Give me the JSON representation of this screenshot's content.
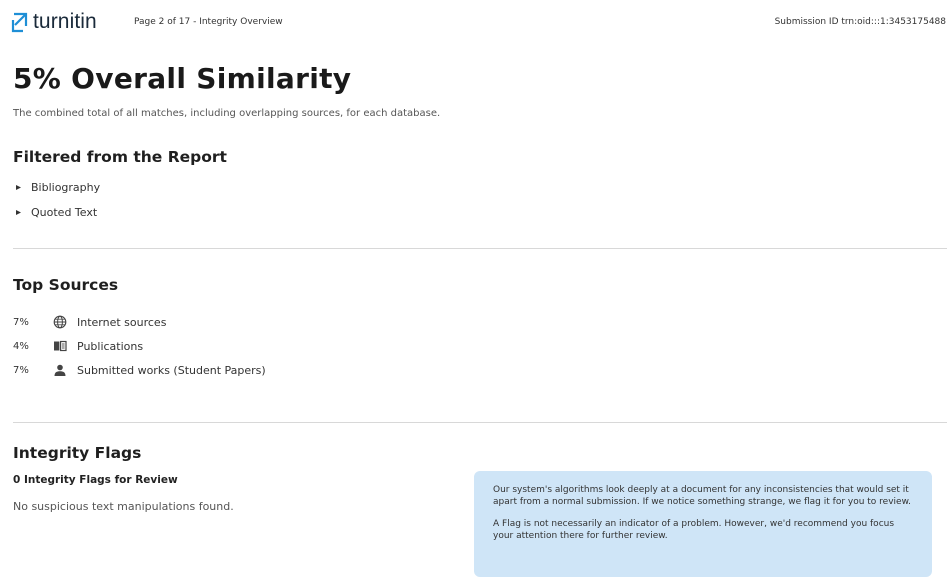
{
  "header": {
    "logo_text": "turnitin",
    "page_info": "Page 2 of 17 - Integrity Overview",
    "submission_id": "Submission ID  trn:oid:::1:3453175488"
  },
  "overview": {
    "title": "5%  Overall Similarity",
    "subtitle": "The combined total of all matches, including overlapping sources, for each database."
  },
  "filtered": {
    "heading": "Filtered from the Report",
    "items": [
      "Bibliography",
      "Quoted Text"
    ]
  },
  "top_sources": {
    "heading": "Top Sources",
    "items": [
      {
        "pct": "7%",
        "label": "Internet sources",
        "icon": "globe-icon"
      },
      {
        "pct": "4%",
        "label": "Publications",
        "icon": "book-icon"
      },
      {
        "pct": "7%",
        "label": "Submitted works (Student Papers)",
        "icon": "person-icon"
      }
    ]
  },
  "integrity_flags": {
    "heading": "Integrity Flags",
    "count_label": "0 Integrity Flags for Review",
    "status": "No suspicious text manipulations found.",
    "info_p1": "Our system's algorithms look deeply at a document for any inconsistencies that would set it apart from a normal submission. If we notice something strange, we flag it for you to review.",
    "info_p2": "A Flag is not necessarily an indicator of a problem. However, we'd recommend you focus your attention there for further review."
  },
  "colors": {
    "logo_accent": "#1f8fd6",
    "info_box_bg": "#cfe5f7"
  }
}
